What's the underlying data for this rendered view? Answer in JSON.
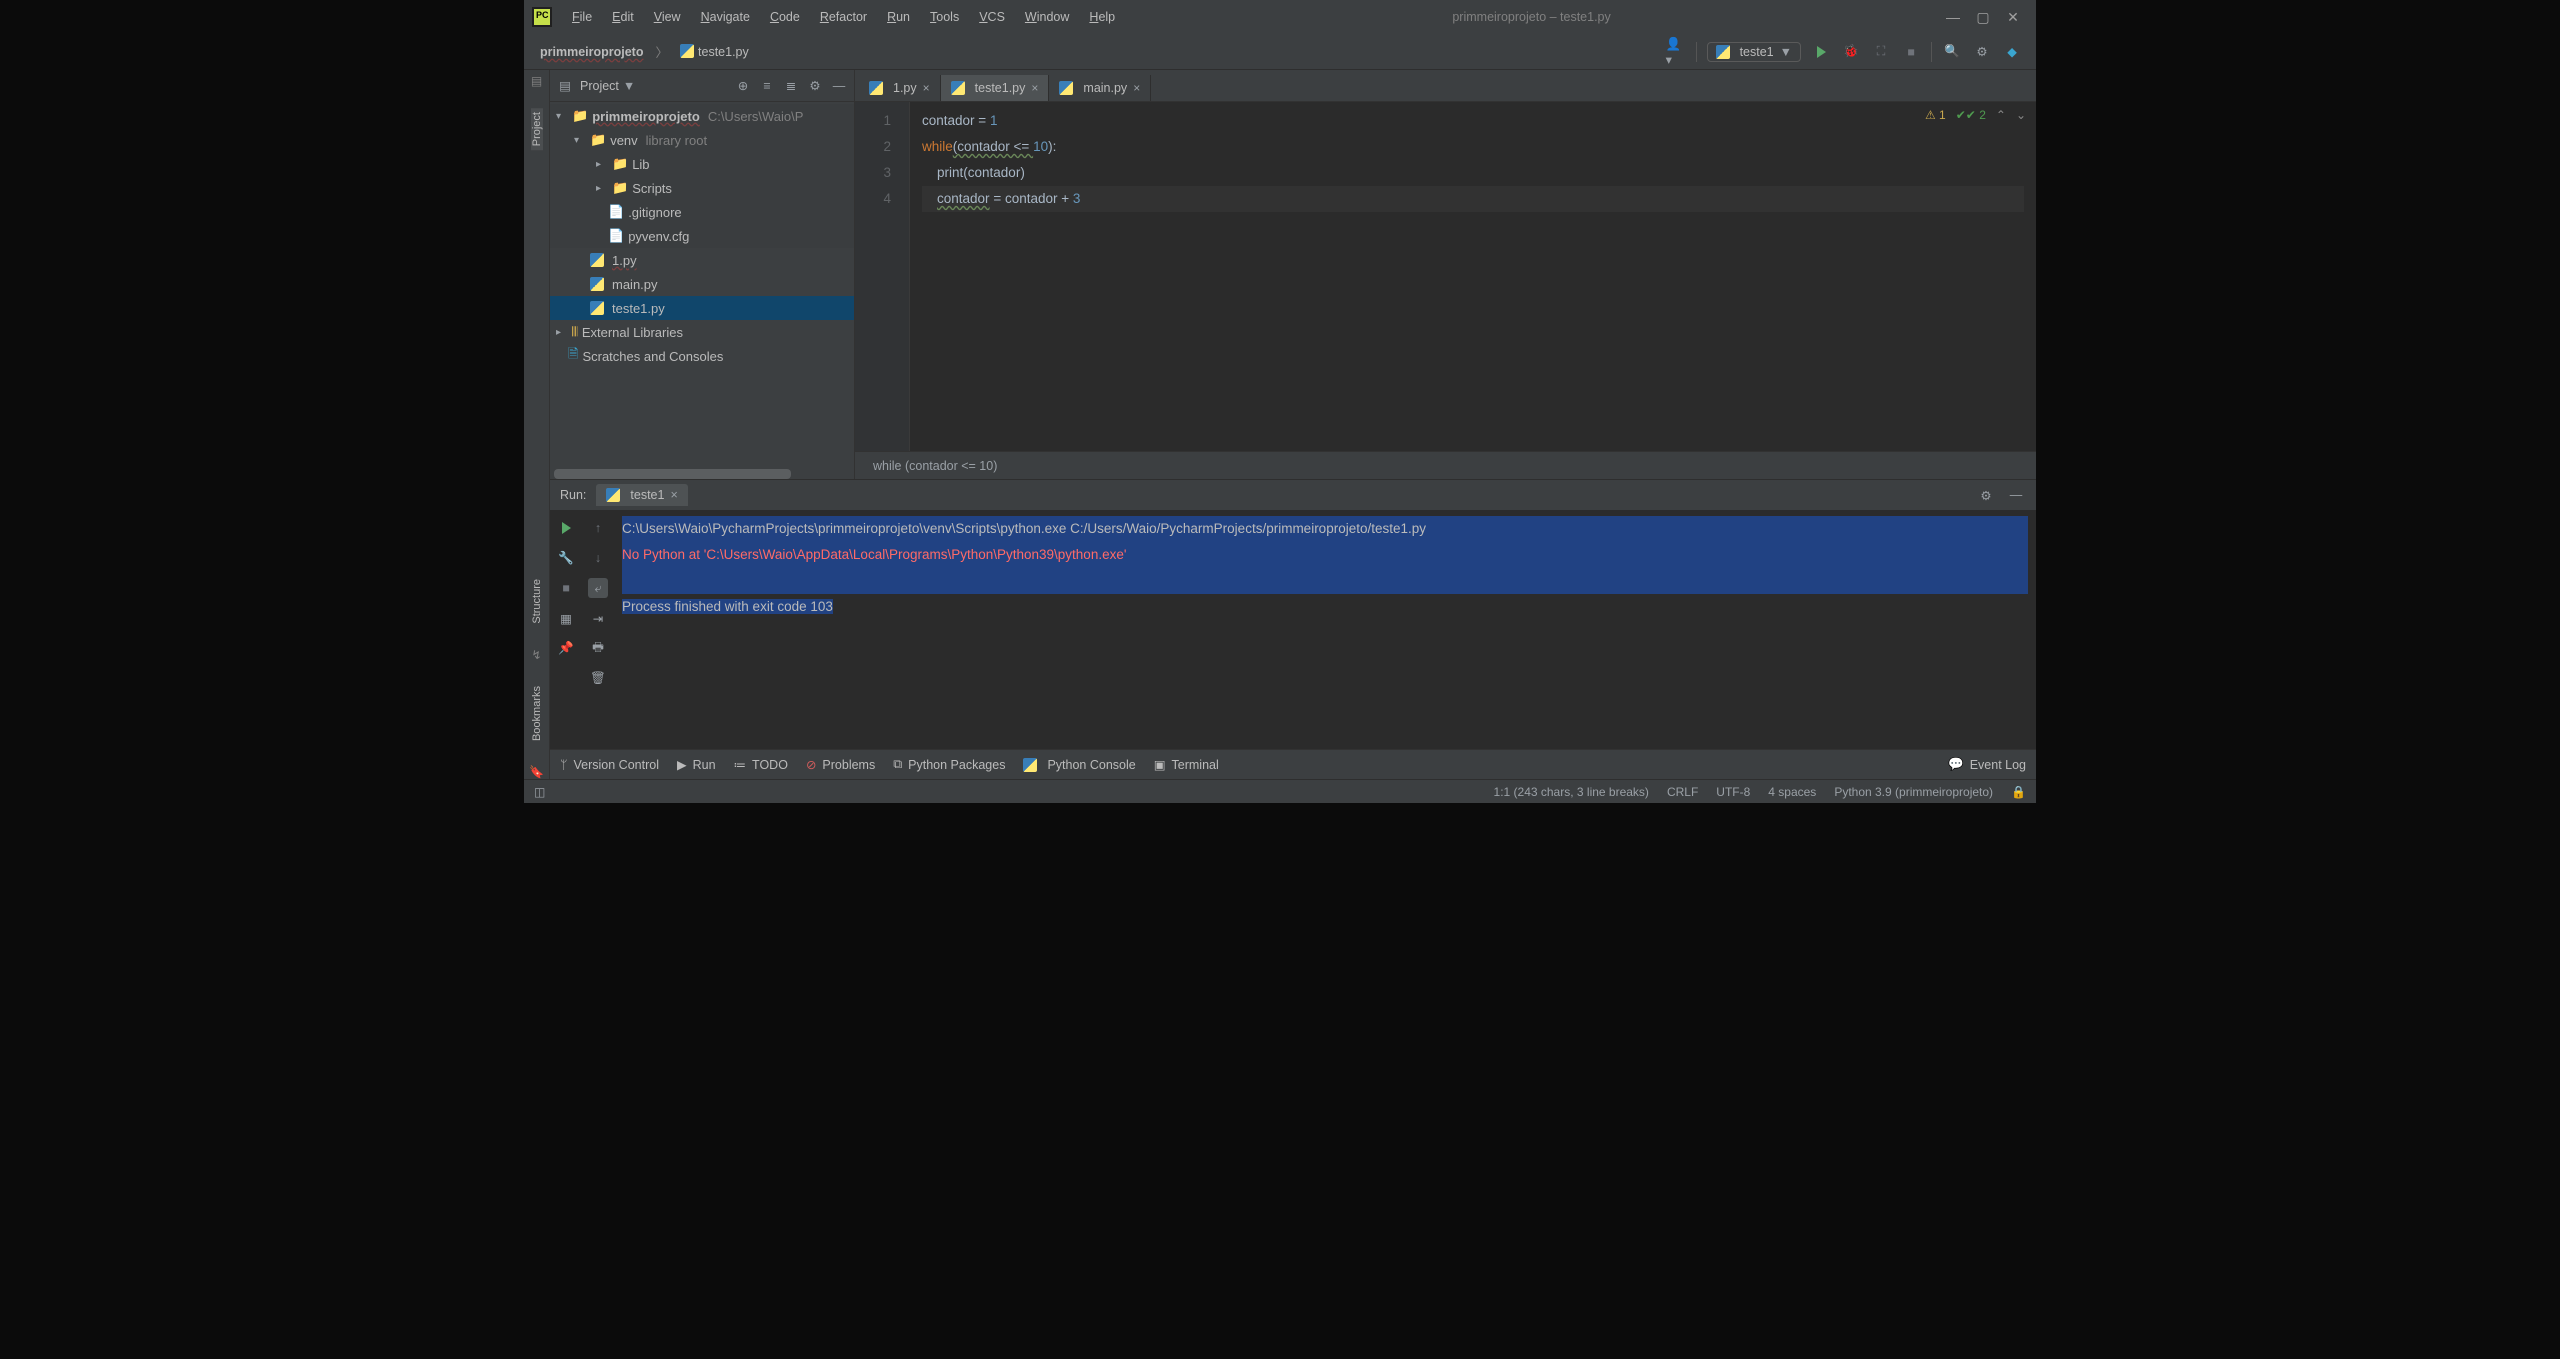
{
  "menu": [
    "File",
    "Edit",
    "View",
    "Navigate",
    "Code",
    "Refactor",
    "Run",
    "Tools",
    "VCS",
    "Window",
    "Help"
  ],
  "window_title": "primmeiroprojeto – teste1.py",
  "breadcrumb": {
    "project": "primmeiroprojeto",
    "file": "teste1.py"
  },
  "run_config": {
    "name": "teste1"
  },
  "project_panel": {
    "title": "Project",
    "root": {
      "name": "primmeiroprojeto",
      "path": "C:\\Users\\Waio\\P"
    },
    "venv_label": "venv",
    "venv_hint": "library root",
    "venv_children": [
      "Lib",
      "Scripts",
      ".gitignore",
      "pyvenv.cfg"
    ],
    "py_files": [
      "1.py",
      "main.py",
      "teste1.py"
    ],
    "external": "External Libraries",
    "scratches": "Scratches and Consoles"
  },
  "tabs": [
    {
      "name": "1.py",
      "active": false
    },
    {
      "name": "teste1.py",
      "active": true
    },
    {
      "name": "main.py",
      "active": false
    }
  ],
  "code": {
    "lines": [
      {
        "n": 1,
        "segments": [
          {
            "t": "contador ",
            "c": ""
          },
          {
            "t": "= ",
            "c": ""
          },
          {
            "t": "1",
            "c": "num"
          }
        ]
      },
      {
        "n": 2,
        "segments": [
          {
            "t": "while",
            "c": "kw"
          },
          {
            "t": "(contador <= ",
            "c": "wavy"
          },
          {
            "t": "10",
            "c": "num"
          },
          {
            "t": "):",
            "c": ""
          }
        ]
      },
      {
        "n": 3,
        "segments": [
          {
            "t": "    ",
            "c": ""
          },
          {
            "t": "print",
            "c": "fn"
          },
          {
            "t": "(contador)",
            "c": ""
          }
        ]
      },
      {
        "n": 4,
        "segments": [
          {
            "t": "    ",
            "c": ""
          },
          {
            "t": "contador",
            "c": "wavy"
          },
          {
            "t": " = contador + ",
            "c": ""
          },
          {
            "t": "3",
            "c": "num"
          }
        ],
        "current": true
      }
    ],
    "breadcrumb": "while (contador <= 10)",
    "inspections": {
      "warnings": "1",
      "passes": "2"
    }
  },
  "run": {
    "title": "Run:",
    "tab": "teste1",
    "output": [
      {
        "text": "C:\\Users\\Waio\\PycharmProjects\\primmeiroprojeto\\venv\\Scripts\\python.exe C:/Users/Waio/PycharmProjects/primmeiroprojeto/teste1.py",
        "cls": "path",
        "sel": true
      },
      {
        "text": "No Python at 'C:\\Users\\Waio\\AppData\\Local\\Programs\\Python\\Python39\\python.exe'",
        "cls": "err",
        "sel": true
      },
      {
        "text": "",
        "cls": "",
        "sel": true
      },
      {
        "text": "Process finished with exit code 103",
        "cls": "",
        "sel": "partial"
      }
    ]
  },
  "bottom": {
    "items": [
      "Version Control",
      "Run",
      "TODO",
      "Problems",
      "Python Packages",
      "Python Console",
      "Terminal"
    ],
    "event_log": "Event Log"
  },
  "status": {
    "pos": "1:1 (243 chars, 3 line breaks)",
    "sep": "CRLF",
    "enc": "UTF-8",
    "indent": "4 spaces",
    "interp": "Python 3.9 (primmeiroprojeto)"
  },
  "left_rail": [
    "Project",
    "Bookmarks",
    "Structure"
  ]
}
